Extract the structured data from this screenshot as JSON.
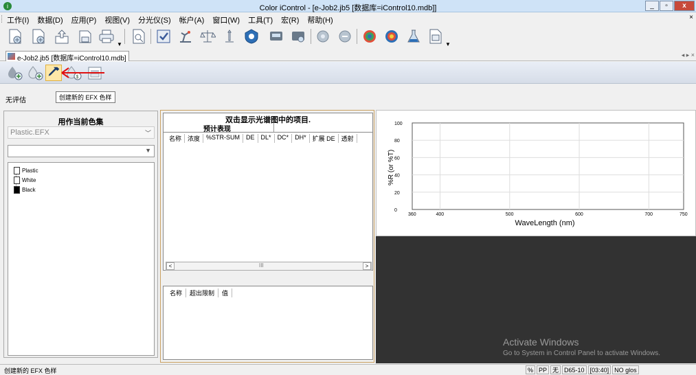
{
  "window": {
    "title": "Color iControl - [e-Job2.jb5 [数据库=iControl10.mdb]]",
    "minimize": "_",
    "restore": "▫",
    "close": "x"
  },
  "menu": [
    "工作(I)",
    "数据(D)",
    "应用(P)",
    "视图(V)",
    "分光仪(S)",
    "帐户(A)",
    "窗口(W)",
    "工具(T)",
    "宏(R)",
    "帮助(H)"
  ],
  "menu_end": "×",
  "doc_tab": {
    "label": "e-Job2.jb5 [数据库=iControl10.mdb]",
    "nav": "◂ ▸ ×"
  },
  "status": {
    "evaluation": "无评估",
    "tooltip": "创建新的 EFX 色样"
  },
  "left_panel": {
    "header": "用作当前色集",
    "colorset": "Plastic.EFX",
    "tree": [
      {
        "label": "Plastic",
        "swatch": "#ffffff"
      },
      {
        "label": "White",
        "swatch": "#ffffff"
      },
      {
        "label": "Black",
        "swatch": "#000000"
      }
    ]
  },
  "mid_panel": {
    "caption": "双击显示光谱图中的项目.",
    "subcaption": "预计表现",
    "columns": [
      "名称",
      "浓度",
      "%STR-SUM",
      "DE",
      "DL*",
      "DC*",
      "DH*",
      "扩展 DE",
      "透射"
    ],
    "scroll_left": "<",
    "scroll_right": ">",
    "scroll_thumb": "III",
    "columns2": [
      "名称",
      "超出限制",
      "值"
    ]
  },
  "chart_data": {
    "type": "line",
    "xlabel": "WaveLength (nm)",
    "ylabel": "%R (or %T)",
    "xlim": [
      360,
      750
    ],
    "ylim": [
      0,
      100
    ],
    "xticks": [
      360,
      400,
      500,
      600,
      700,
      750
    ],
    "yticks": [
      0,
      20,
      40,
      60,
      80,
      100
    ],
    "grid": true,
    "series": []
  },
  "watermark": {
    "line1": "Activate Windows",
    "line2": "Go to System in Control Panel to activate Windows."
  },
  "statusbar": {
    "message": "创建新的 EFX 色样",
    "cells": [
      "%",
      "PP",
      "无",
      "D65-10",
      "[03:40]",
      "NO glos"
    ]
  },
  "colors": {
    "accent": "#c74a3a",
    "chart_bg": "#ffffff",
    "dark_panel": "#323232"
  }
}
